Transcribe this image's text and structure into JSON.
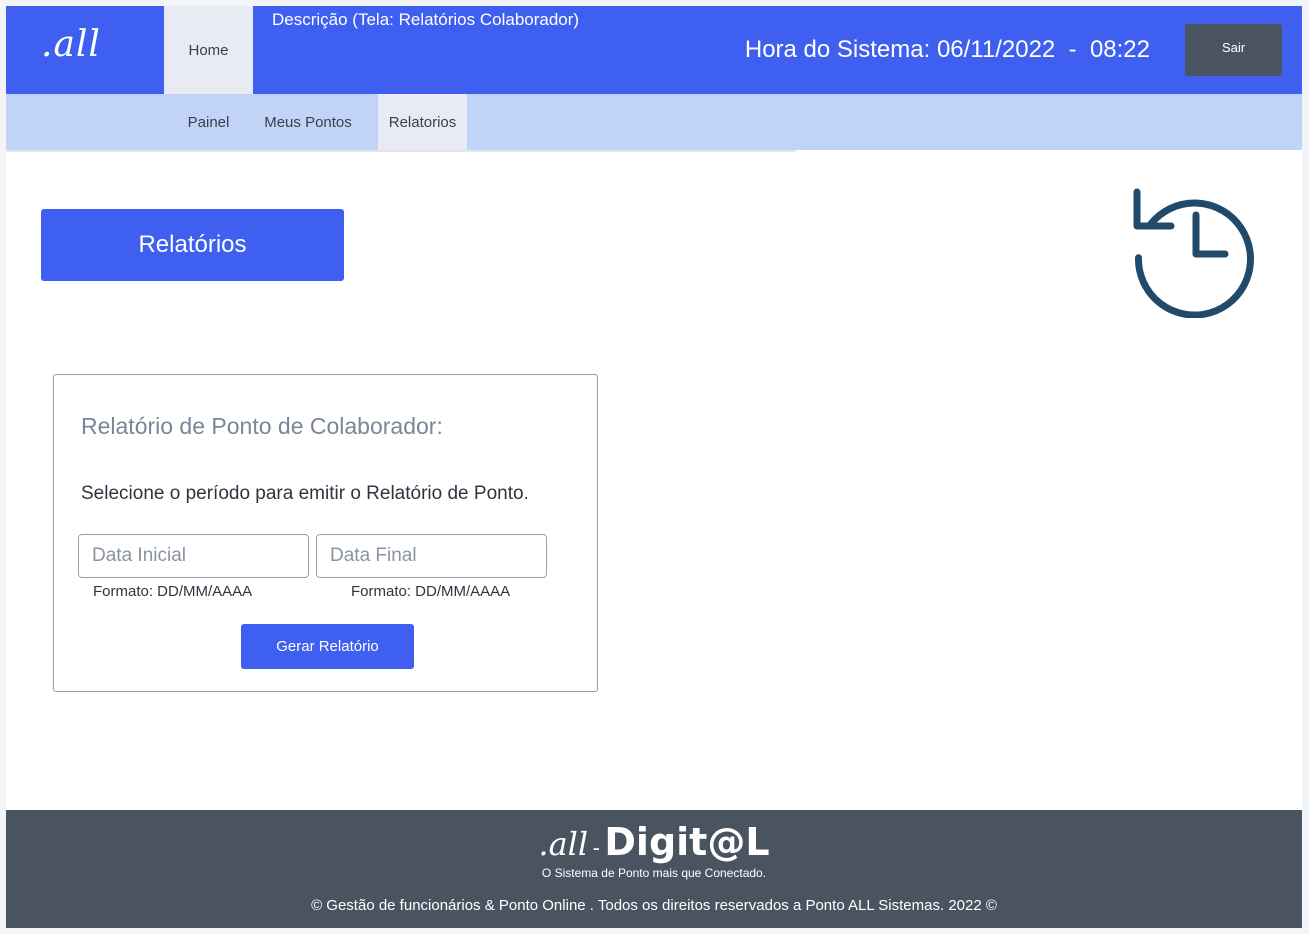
{
  "header": {
    "logo_text": ".all",
    "home_label": "Home",
    "description": "Descrição (Tela: Relatórios Colaborador)",
    "clock_label": "Hora do Sistema: 06/11/2022  -  08:22",
    "logout_label": "Sair"
  },
  "subnav": {
    "items": [
      {
        "label": "Painel"
      },
      {
        "label": "Meus Pontos"
      },
      {
        "label": "Relatorios",
        "active": true
      }
    ]
  },
  "banner": {
    "label": "Relatórios",
    "icon": "history-clock-icon",
    "icon_color": "#1f4a6b"
  },
  "report_card": {
    "title": "Relatório de Ponto de Colaborador:",
    "subtitle": "Selecione o período para emitir o Relatório de Ponto.",
    "start_date": {
      "value": "",
      "placeholder": "Data Inicial",
      "hint": "Formato: DD/MM/AAAA"
    },
    "end_date": {
      "value": "",
      "placeholder": "Data Final",
      "hint": "Formato: DD/MM/AAAA"
    },
    "submit_label": "Gerar Relatório"
  },
  "footer": {
    "brand_all": ".all",
    "brand_dash": "-",
    "brand_digital": "Digit@L",
    "tagline": "O Sistema de Ponto mais que Conectado.",
    "copyright": "© Gestão de funcionários & Ponto Online .  Todos os direitos reservados a Ponto ALL Sistemas.  2022 ©"
  },
  "colors": {
    "primary": "#3e5ff0",
    "subnav_bg": "#c2d3f8",
    "active_tab_bg": "#e9ebf3",
    "dark": "#4a5460",
    "icon": "#1f4a6b"
  }
}
